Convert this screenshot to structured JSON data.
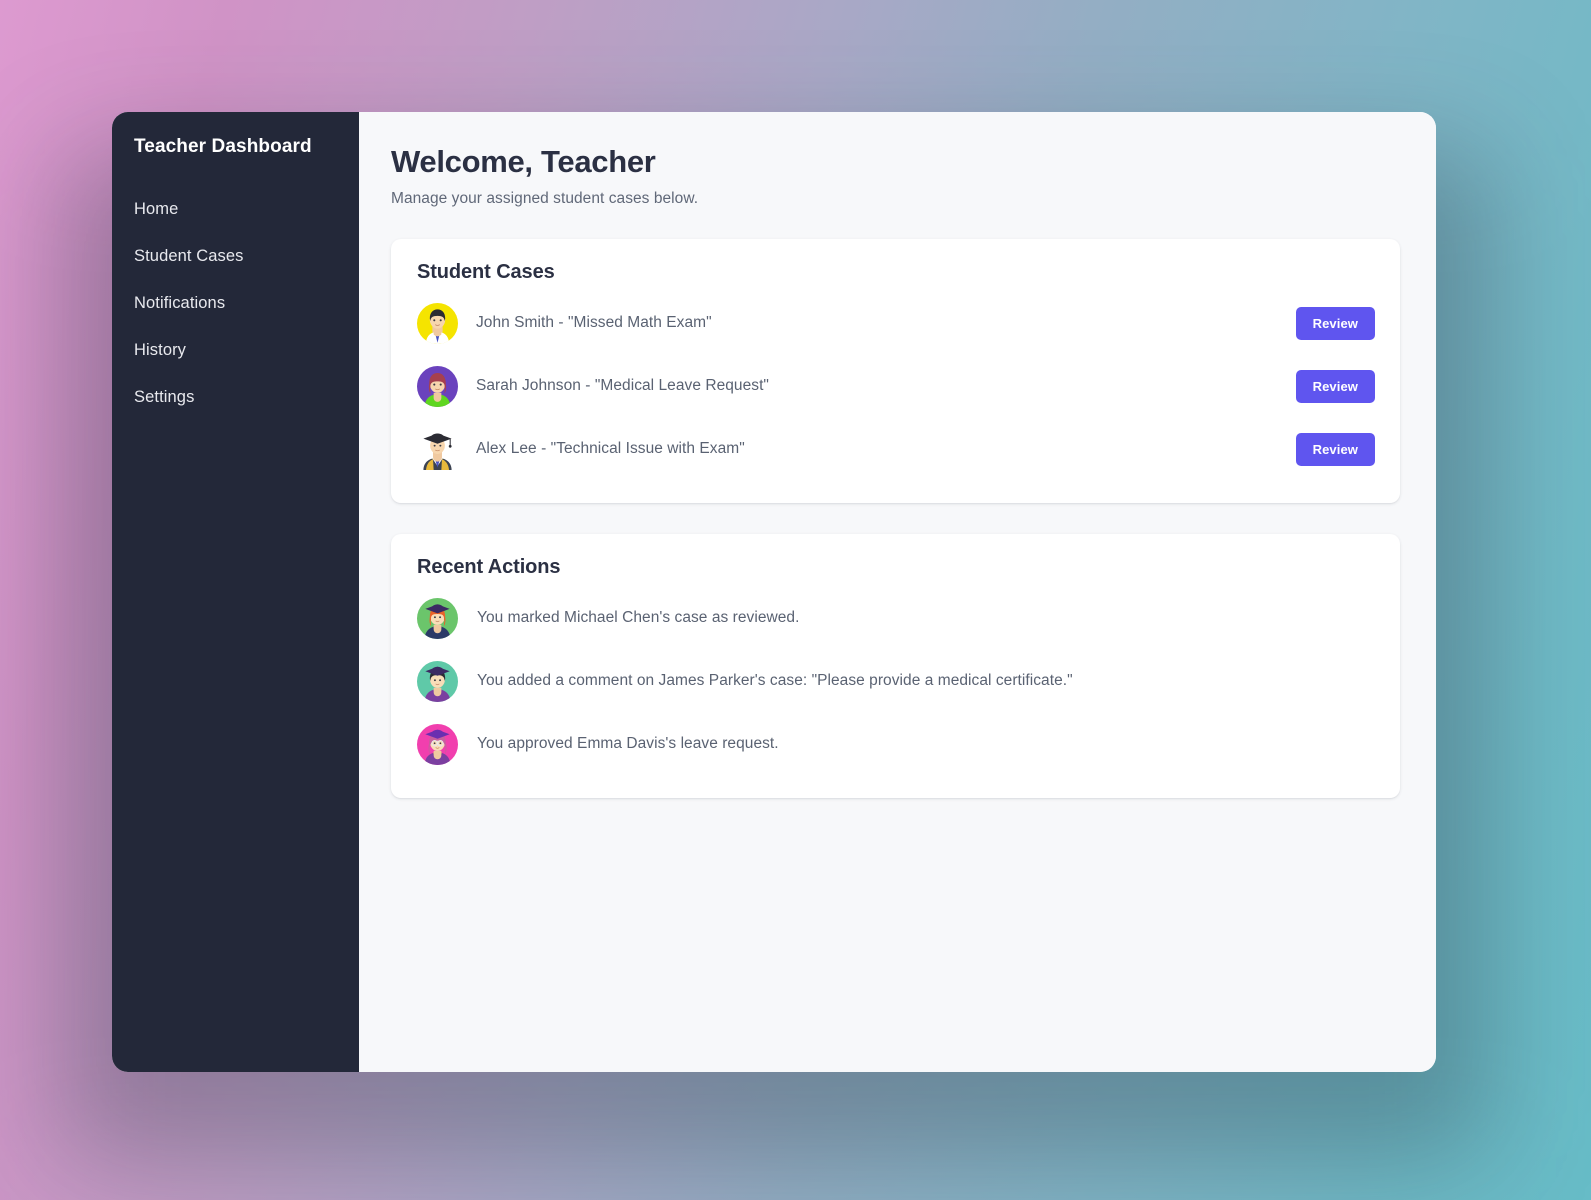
{
  "theme": {
    "accent": "#5f55ef",
    "sidebar_bg": "#232839",
    "content_bg": "#f7f8fa",
    "card_bg": "#ffffff",
    "heading_color": "#2b3043",
    "body_text_color": "#5a6272",
    "background_gradient_from": "#dd9ad0",
    "background_gradient_mid": "#a9a8c6",
    "background_gradient_to": "#67bcc7"
  },
  "sidebar": {
    "title": "Teacher Dashboard",
    "items": [
      {
        "label": "Home"
      },
      {
        "label": "Student Cases"
      },
      {
        "label": "Notifications"
      },
      {
        "label": "History"
      },
      {
        "label": "Settings"
      }
    ]
  },
  "header": {
    "title": "Welcome, Teacher",
    "subtitle": "Manage your assigned student cases below."
  },
  "student_cases": {
    "title": "Student Cases",
    "rows": [
      {
        "text": "John Smith - \"Missed Math Exam\"",
        "button_label": "Review",
        "avatar": "avatar-man-yellow"
      },
      {
        "text": "Sarah Johnson - \"Medical Leave Request\"",
        "button_label": "Review",
        "avatar": "avatar-woman-purple"
      },
      {
        "text": "Alex Lee - \"Technical Issue with Exam\"",
        "button_label": "Review",
        "avatar": "avatar-graduate-plain"
      }
    ]
  },
  "recent_actions": {
    "title": "Recent Actions",
    "rows": [
      {
        "text": "You marked Michael Chen's case as reviewed.",
        "avatar": "avatar-graduate-green"
      },
      {
        "text": "You added a comment on James Parker's case: \"Please provide a medical certificate.\"",
        "avatar": "avatar-graduate-teal"
      },
      {
        "text": "You approved Emma Davis's leave request.",
        "avatar": "avatar-graduate-pink"
      }
    ]
  }
}
